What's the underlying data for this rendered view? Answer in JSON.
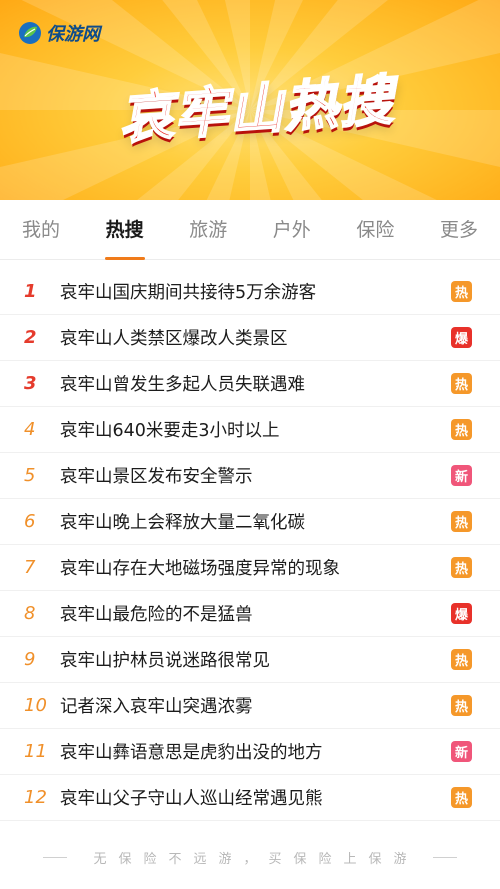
{
  "brand": {
    "logo_text": "保游网"
  },
  "hero": {
    "title_main": "哀牢山",
    "title_accent": "热搜"
  },
  "tabs": [
    {
      "label": "我的",
      "active": false
    },
    {
      "label": "热搜",
      "active": true
    },
    {
      "label": "旅游",
      "active": false
    },
    {
      "label": "户外",
      "active": false
    },
    {
      "label": "保险",
      "active": false
    },
    {
      "label": "更多",
      "active": false
    }
  ],
  "badge_colors": {
    "热": "#f5982a",
    "爆": "#e8312a",
    "新": "#f0567a"
  },
  "hot_list": [
    {
      "rank": "1",
      "title": "哀牢山国庆期间共接待5万余游客",
      "badge": "热"
    },
    {
      "rank": "2",
      "title": "哀牢山人类禁区爆改人类景区",
      "badge": "爆"
    },
    {
      "rank": "3",
      "title": "哀牢山曾发生多起人员失联遇难",
      "badge": "热"
    },
    {
      "rank": "4",
      "title": "哀牢山640米要走3小时以上",
      "badge": "热"
    },
    {
      "rank": "5",
      "title": "哀牢山景区发布安全警示",
      "badge": "新"
    },
    {
      "rank": "6",
      "title": "哀牢山晚上会释放大量二氧化碳",
      "badge": "热"
    },
    {
      "rank": "7",
      "title": "哀牢山存在大地磁场强度异常的现象",
      "badge": "热"
    },
    {
      "rank": "8",
      "title": "哀牢山最危险的不是猛兽",
      "badge": "爆"
    },
    {
      "rank": "9",
      "title": "哀牢山护林员说迷路很常见",
      "badge": "热"
    },
    {
      "rank": "10",
      "title": "记者深入哀牢山突遇浓雾",
      "badge": "热"
    },
    {
      "rank": "11",
      "title": "哀牢山彝语意思是虎豹出没的地方",
      "badge": "新"
    },
    {
      "rank": "12",
      "title": "哀牢山父子守山人巡山经常遇见熊",
      "badge": "热"
    }
  ],
  "footer": {
    "slogan": "无保险不远游，买保险上保游"
  }
}
